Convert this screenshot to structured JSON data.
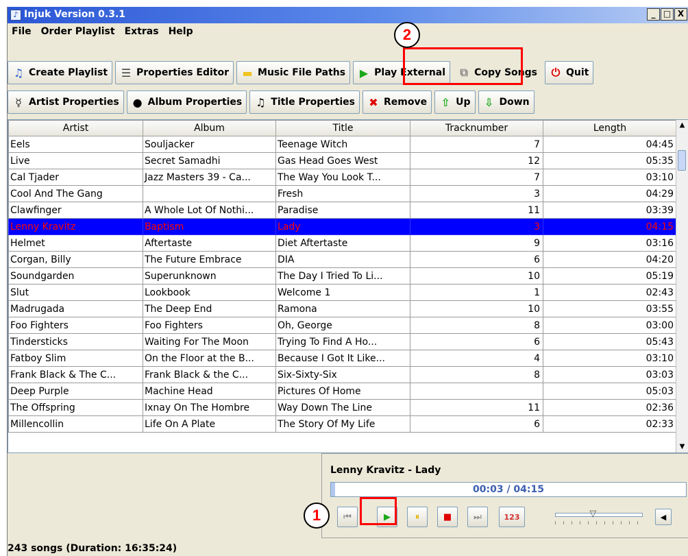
{
  "window": {
    "title": "Injuk Version 0.3.1",
    "minimize": "_",
    "maximize": "□",
    "close": "X"
  },
  "menu": [
    {
      "label": "File"
    },
    {
      "label": "Order Playlist"
    },
    {
      "label": "Extras"
    },
    {
      "label": "Help"
    }
  ],
  "toolbar1": [
    {
      "id": "create-playlist",
      "label": "Create Playlist",
      "icon": "playlist-icon",
      "glyph": "♫",
      "color": "#2a5cc8"
    },
    {
      "id": "properties-editor",
      "label": "Properties Editor",
      "icon": "list-icon",
      "glyph": "☰",
      "color": "#444444"
    },
    {
      "id": "music-file-paths",
      "label": "Music File Paths",
      "icon": "folder-icon",
      "glyph": "▬",
      "color": "#f0c420"
    },
    {
      "id": "play-external",
      "label": "Play External",
      "icon": "play-icon",
      "glyph": "▶",
      "color": "#1aa81a"
    },
    {
      "id": "copy-songs",
      "label": "Copy Songs",
      "icon": "copy-icon",
      "glyph": "⧉",
      "color": "#888888"
    },
    {
      "id": "quit",
      "label": "Quit",
      "icon": "power-icon",
      "glyph": "⏻",
      "color": "#e00000"
    }
  ],
  "toolbar2": [
    {
      "id": "artist-properties",
      "label": "Artist Properties",
      "icon": "person-icon",
      "glyph": "☿",
      "color": "#333333"
    },
    {
      "id": "album-properties",
      "label": "Album Properties",
      "icon": "disc-icon",
      "glyph": "●",
      "color": "#000000"
    },
    {
      "id": "title-properties",
      "label": "Title Properties",
      "icon": "music-note-icon",
      "glyph": "♫",
      "color": "#000000"
    },
    {
      "id": "remove",
      "label": "Remove",
      "icon": "x-icon",
      "glyph": "✖",
      "color": "#e00000"
    },
    {
      "id": "up",
      "label": "Up",
      "icon": "arrow-up-icon",
      "glyph": "⇧",
      "color": "#1aa81a"
    },
    {
      "id": "down",
      "label": "Down",
      "icon": "arrow-down-icon",
      "glyph": "⇩",
      "color": "#1aa81a"
    }
  ],
  "table": {
    "columns": [
      "Artist",
      "Album",
      "Title",
      "Tracknumber",
      "Length"
    ],
    "rows": [
      [
        "Eels",
        "Souljacker",
        "Teenage Witch",
        "7",
        "04:45"
      ],
      [
        "Live",
        "Secret Samadhi",
        "Gas Head Goes West",
        "12",
        "05:35"
      ],
      [
        "Cal Tjader",
        "Jazz Masters 39 - Ca...",
        "The Way You Look T...",
        "7",
        "03:10"
      ],
      [
        "Cool And The Gang",
        "",
        "Fresh",
        "3",
        "04:29"
      ],
      [
        "Clawfinger",
        "A Whole Lot Of Nothi...",
        "Paradise",
        "11",
        "03:39"
      ],
      [
        "Lenny Kravitz",
        "Baptism",
        "Lady",
        "3",
        "04:15"
      ],
      [
        "Helmet",
        "Aftertaste",
        "Diet Aftertaste",
        "9",
        "03:16"
      ],
      [
        "Corgan, Billy",
        "The Future Embrace",
        "DIA",
        "6",
        "04:20"
      ],
      [
        "Soundgarden",
        "Superunknown",
        "The Day I Tried To Li...",
        "10",
        "05:19"
      ],
      [
        "Slut",
        "Lookbook",
        "Welcome 1",
        "1",
        "02:43"
      ],
      [
        "Madrugada",
        "The Deep End",
        "Ramona",
        "10",
        "03:55"
      ],
      [
        "Foo Fighters",
        "Foo Fighters",
        "Oh, George",
        "8",
        "03:00"
      ],
      [
        "Tindersticks",
        "Waiting For The Moon",
        "Trying To Find A Ho...",
        "6",
        "05:43"
      ],
      [
        "Fatboy Slim",
        "On the Floor at the B...",
        "Because I Got It Like...",
        "4",
        "03:10"
      ],
      [
        "Frank Black & The C...",
        "Frank Black & the C...",
        "Six-Sixty-Six",
        "8",
        "03:03"
      ],
      [
        "Deep Purple",
        "Machine Head",
        "Pictures Of Home",
        "",
        "05:03"
      ],
      [
        "The Offspring",
        "Ixnay On The Hombre",
        "Way Down The Line",
        "11",
        "02:36"
      ],
      [
        "Millencollin",
        "Life On A Plate",
        "The Story Of My Life",
        "6",
        "02:33"
      ]
    ],
    "selected_index": 5
  },
  "player": {
    "now_playing": "Lenny Kravitz - Lady",
    "time": "00:03 / 04:15",
    "progress": 0.012,
    "volume": 0.45,
    "buttons": [
      {
        "id": "previous",
        "icon": "skip-back-icon",
        "glyph": "⏮",
        "color": "#8a8a8a"
      },
      {
        "id": "play",
        "icon": "play-icon",
        "glyph": "▶",
        "color": "#1aa81a"
      },
      {
        "id": "pause",
        "icon": "pause-icon",
        "glyph": "⏸",
        "color": "#e0b000"
      },
      {
        "id": "stop",
        "icon": "stop-icon",
        "glyph": "■",
        "color": "#e00000"
      },
      {
        "id": "next",
        "icon": "skip-forward-icon",
        "glyph": "⏭",
        "color": "#8a8a8a"
      },
      {
        "id": "shuffle",
        "icon": "shuffle-icon",
        "glyph": "123",
        "color": "#d03030"
      }
    ],
    "mute_glyph": "◀"
  },
  "status": "243 songs (Duration: 16:35:24)",
  "annotations": [
    {
      "label": "1"
    },
    {
      "label": "2"
    }
  ]
}
